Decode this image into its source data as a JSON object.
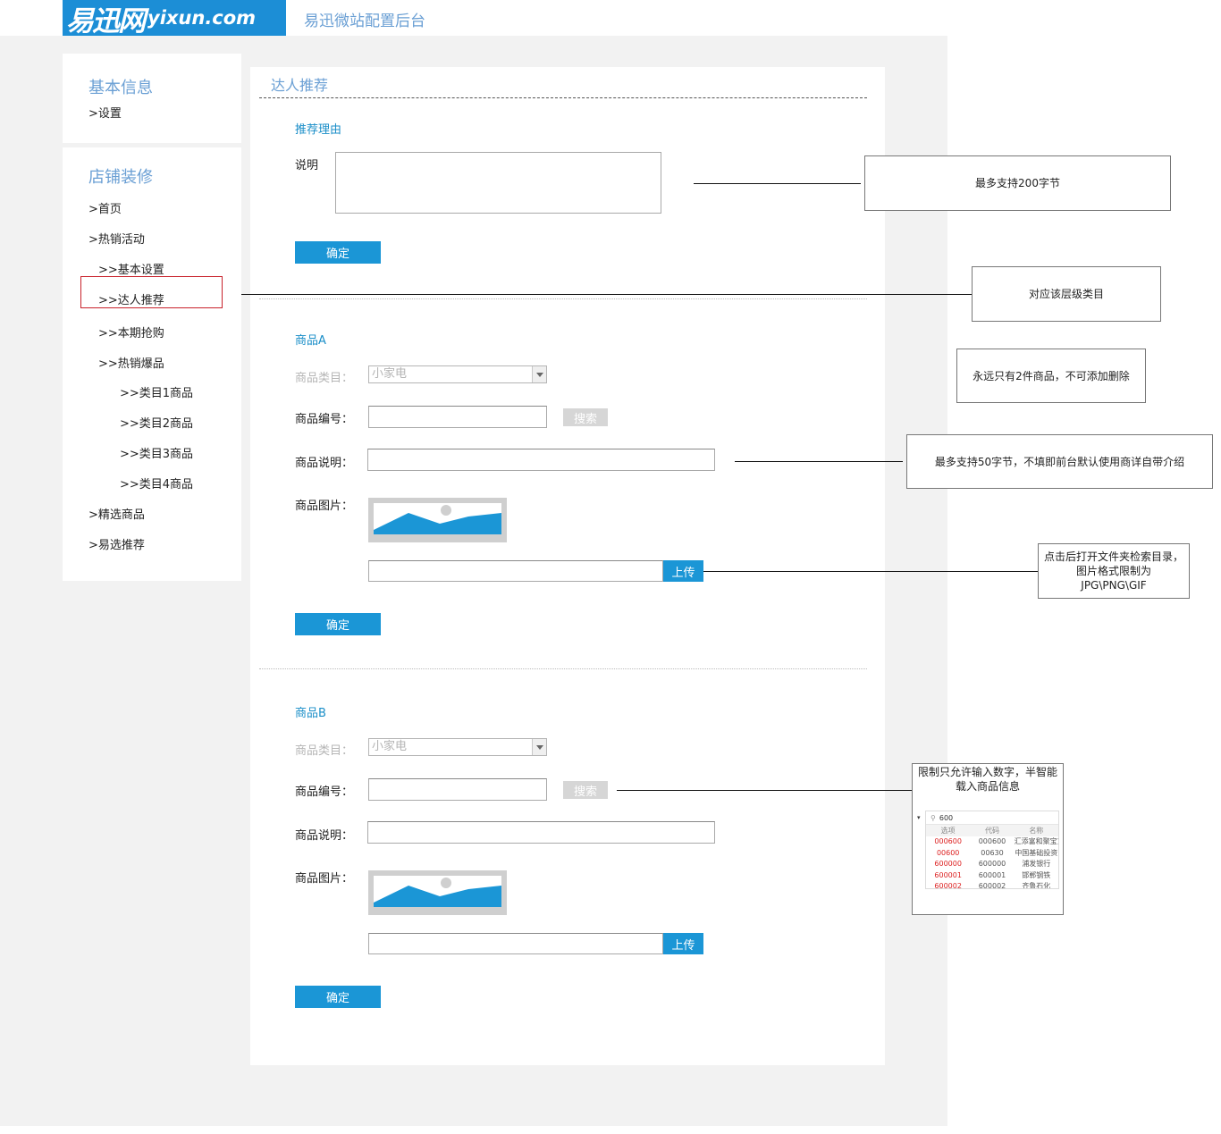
{
  "header": {
    "logo_cn": "易迅网",
    "logo_en": "yixun.com",
    "app_title": "易迅微站配置后台"
  },
  "sidebar": {
    "group1": {
      "title": "基本信息",
      "items": [
        ">设置"
      ]
    },
    "group2": {
      "title": "店铺装修",
      "items": [
        ">首页",
        ">热销活动",
        ">>基本设置",
        ">>达人推荐",
        ">>本期抢购",
        ">>热销爆品",
        ">>类目1商品",
        ">>类目2商品",
        ">>类目3商品",
        ">>类目4商品",
        ">精选商品",
        ">易选推荐"
      ],
      "active": ">>达人推荐"
    }
  },
  "main": {
    "title": "达人推荐",
    "reason": {
      "section_title": "推荐理由",
      "desc_label": "说明",
      "desc_value": "",
      "confirm_label": "确定"
    },
    "product_a": {
      "section_title": "商品A",
      "category_label": "商品类目：",
      "category_value": "小家电",
      "code_label": "商品编号：",
      "code_value": "",
      "search_label": "搜索",
      "desc_label": "商品说明：",
      "desc_value": "",
      "image_label": "商品图片：",
      "upload_label": "上传",
      "upload_value": "",
      "confirm_label": "确定"
    },
    "product_b": {
      "section_title": "商品B",
      "category_label": "商品类目：",
      "category_value": "小家电",
      "code_label": "商品编号：",
      "code_value": "",
      "search_label": "搜索",
      "desc_label": "商品说明：",
      "desc_value": "",
      "image_label": "商品图片：",
      "upload_label": "上传",
      "upload_value": "",
      "confirm_label": "确定"
    }
  },
  "annotations": {
    "desc_limit": "最多支持200字节",
    "level_category": "对应该层级类目",
    "two_items": "永远只有2件商品，不可添加删除",
    "product_desc_limit": "最多支持50字节，不填即前台默认使用商详自带介绍",
    "upload_note": "点击后打开文件夹检索目录，图片格式限制为JPG\\PNG\\GIF",
    "code_note": "限制只允许输入数字，半智能载入商品信息"
  },
  "autocomplete_sample": {
    "query": "600",
    "headers": [
      "选项",
      "代码",
      "名称"
    ],
    "rows": [
      [
        "000600",
        "000600",
        "汇添富和聚宝货币"
      ],
      [
        "00600",
        "00630",
        "中国基础投资"
      ],
      [
        "600000",
        "600000",
        "浦发银行"
      ],
      [
        "600001",
        "600001",
        "邯郸钢铁"
      ],
      [
        "600002",
        "600002",
        "齐鲁石化"
      ]
    ]
  },
  "colors": {
    "brand_blue": "#1c8ed6",
    "button_blue": "#1b96d6",
    "heading_blue": "#6a9fd4",
    "section_blue": "#1a8ec8",
    "highlight_red": "#c8212b",
    "canvas_gray": "#f2f2f2"
  }
}
